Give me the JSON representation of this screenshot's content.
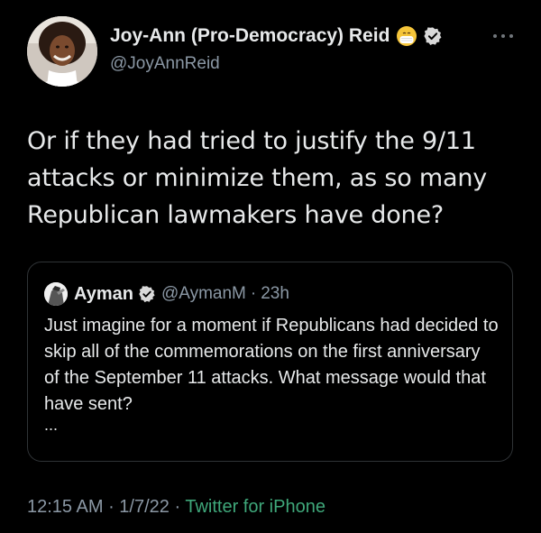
{
  "author": {
    "display_name": "Joy-Ann (Pro-Democracy) Reid",
    "handle": "@JoyAnnReid",
    "emoji_icon": "face-with-medical-mask-emoji",
    "verified_icon": "verified-badge-icon"
  },
  "more_icon": "more-options-icon",
  "tweet": {
    "text": "Or if they had tried to justify the 9/11 attacks or minimize them, as so many Republican lawmakers have done?"
  },
  "quote": {
    "display_name": "Ayman",
    "handle": "@AymanM",
    "separator": "·",
    "time": "23h",
    "text": "Just imagine for a moment if Republicans had decided to skip all of the commemorations on the first anniversary of the September 11 attacks. What message would that have sent?",
    "ellipsis": "..."
  },
  "footer": {
    "time": "12:15 AM",
    "sep1": " · ",
    "date": "1/7/22",
    "sep2": " · ",
    "source": "Twitter for iPhone"
  },
  "colors": {
    "background": "#000000",
    "text": "#e7e9ea",
    "secondary": "#8b98a5",
    "border": "#2f3336",
    "source_link": "#3fa77a",
    "verified": "#d9d9d9"
  }
}
